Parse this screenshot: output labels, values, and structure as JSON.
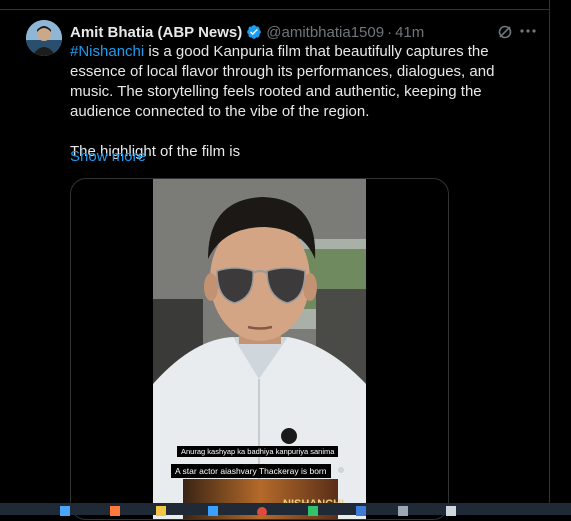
{
  "post": {
    "author_name": "Amit Bhatia (ABP News)",
    "handle": "@amitbhatia1509",
    "separator": "·",
    "time": "41m",
    "hashtag": "#Nishanchi",
    "body_rest": " is a good Kanpuria film that beautifully captures the essence of local flavor through its performances, dialogues, and music. The storytelling feels rooted and authentic, keeping the audience connected to the vibe of the region.",
    "body_para2": "The highlight of the film is",
    "show_more": "Show more"
  },
  "video": {
    "caption_line1": "Anurag kashyap ka badhiya kanpuriya sanima",
    "caption_line2": "A star actor aiashvary Thackeray is born",
    "poster_text": "NISHANCHI"
  },
  "icons": {
    "verified": "verified-badge-icon",
    "grok": "grok-icon",
    "more": "more-options-icon"
  },
  "colors": {
    "background": "#000000",
    "text": "#e7e9ea",
    "muted": "#71767b",
    "link": "#1d9bf0",
    "verified": "#1d9bf0"
  }
}
